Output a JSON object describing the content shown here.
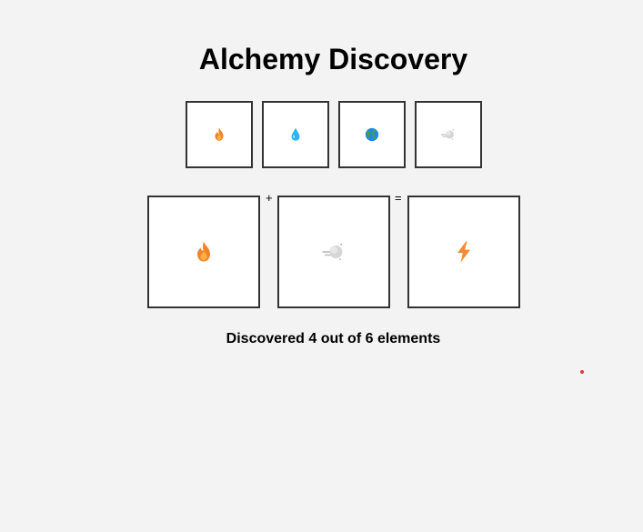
{
  "title": "Alchemy Discovery",
  "inventory": [
    {
      "element": "fire",
      "icon": "fire-icon"
    },
    {
      "element": "water",
      "icon": "water-drop-icon"
    },
    {
      "element": "earth",
      "icon": "earth-globe-icon"
    },
    {
      "element": "air",
      "icon": "air-cloud-icon"
    }
  ],
  "crafting": {
    "slot1": {
      "element": "fire",
      "icon": "fire-icon"
    },
    "plus_symbol": "+",
    "slot2": {
      "element": "air",
      "icon": "air-cloud-icon"
    },
    "equals_symbol": "=",
    "result": {
      "element": "energy",
      "icon": "lightning-icon"
    }
  },
  "status": "Discovered 4 out of 6 elements",
  "colors": {
    "background": "#f3f3f3",
    "border": "#333333",
    "fire_outer": "#f4822a",
    "fire_inner": "#fbb040",
    "water": "#29b6f6",
    "earth_ocean": "#1e88e5",
    "earth_land": "#43a047",
    "air": "#cfcfcf",
    "lightning": "#f68b32",
    "marker": "#e53935"
  }
}
